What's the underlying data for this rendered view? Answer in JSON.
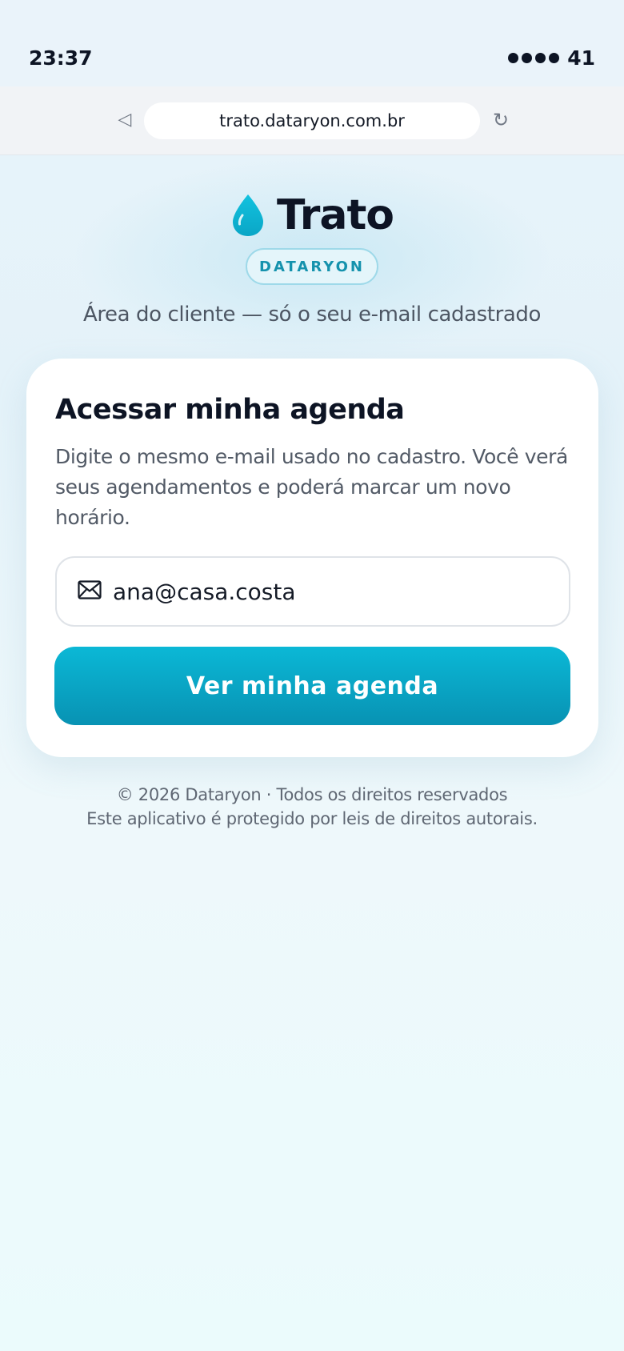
{
  "status_bar": {
    "time": "23:37",
    "battery": "41",
    "signal_icon": "signal-dots-icon"
  },
  "browser": {
    "back_icon": "◁",
    "url": "trato.dataryon.com.br",
    "reload_icon": "↻"
  },
  "brand": {
    "logo_icon": "water-drop-icon",
    "name": "Trato",
    "badge": "DATARYON",
    "tagline": "Área do cliente — só o seu e-mail cadastrado"
  },
  "login_card": {
    "title": "Acessar minha agenda",
    "description": "Digite o mesmo e-mail usado no cadastro. Você verá seus agendamentos e poderá marcar um novo horário.",
    "email_icon": "mail-icon",
    "email_value": "ana@casa.costa",
    "submit_label": "Ver minha agenda"
  },
  "footer": {
    "copyright": "© 2026 Dataryon · Todos os direitos reservados",
    "legal": "Este aplicativo é protegido por leis de direitos autorais."
  },
  "colors": {
    "accent": "#0bb8d6",
    "accent_dark": "#0892b3",
    "text_primary": "#0d1424",
    "badge_text": "#1592ad"
  }
}
